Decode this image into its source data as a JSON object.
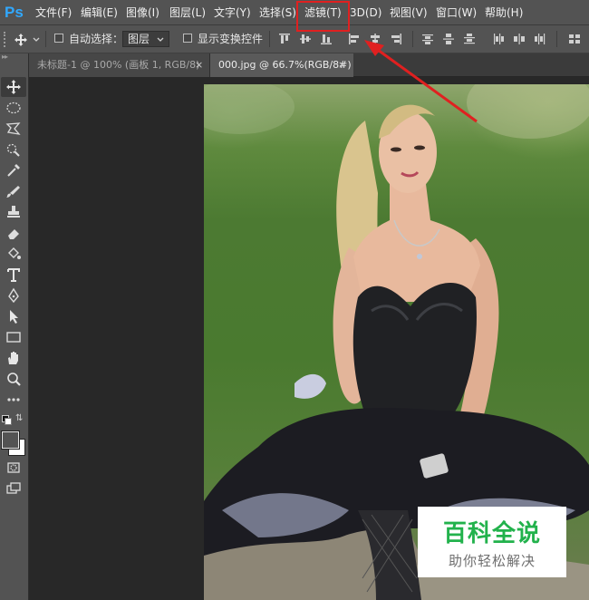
{
  "app": {
    "logo": "Ps",
    "accent_color": "#31a8ff"
  },
  "menu": {
    "items": [
      "文件(F)",
      "编辑(E)",
      "图像(I)",
      "图层(L)",
      "文字(Y)",
      "选择(S)",
      "滤镜(T)",
      "3D(D)",
      "视图(V)",
      "窗口(W)",
      "帮助(H)"
    ],
    "highlighted_item": "滤镜(T)",
    "highlight_color": "#e02020"
  },
  "options_bar": {
    "auto_select_label": "自动选择：",
    "auto_select_checked": false,
    "layer_dropdown_value": "图层",
    "show_transform_label": "显示变换控件",
    "show_transform_checked": false
  },
  "tabs": [
    {
      "label": "未标题-1 @ 100% (画板 1, RGB/8)",
      "close": "×",
      "active": false
    },
    {
      "label": "000.jpg @ 66.7%(RGB/8#)",
      "close": "×",
      "active": true
    }
  ],
  "toolbar": {
    "tools": [
      "move-tool-icon",
      "marquee-tool-icon",
      "lasso-tool-icon",
      "quick-select-tool-icon",
      "eyedropper-tool-icon",
      "brush-tool-icon",
      "stamp-tool-icon",
      "eraser-tool-icon",
      "paint-bucket-tool-icon",
      "type-tool-icon",
      "pen-tool-icon",
      "path-select-tool-icon",
      "rectangle-tool-icon",
      "hand-tool-icon",
      "zoom-tool-icon",
      "more-tools-icon"
    ]
  },
  "watermark": {
    "title": "百科全说",
    "subtitle": "助你轻松解决",
    "title_color": "#22b24c"
  }
}
